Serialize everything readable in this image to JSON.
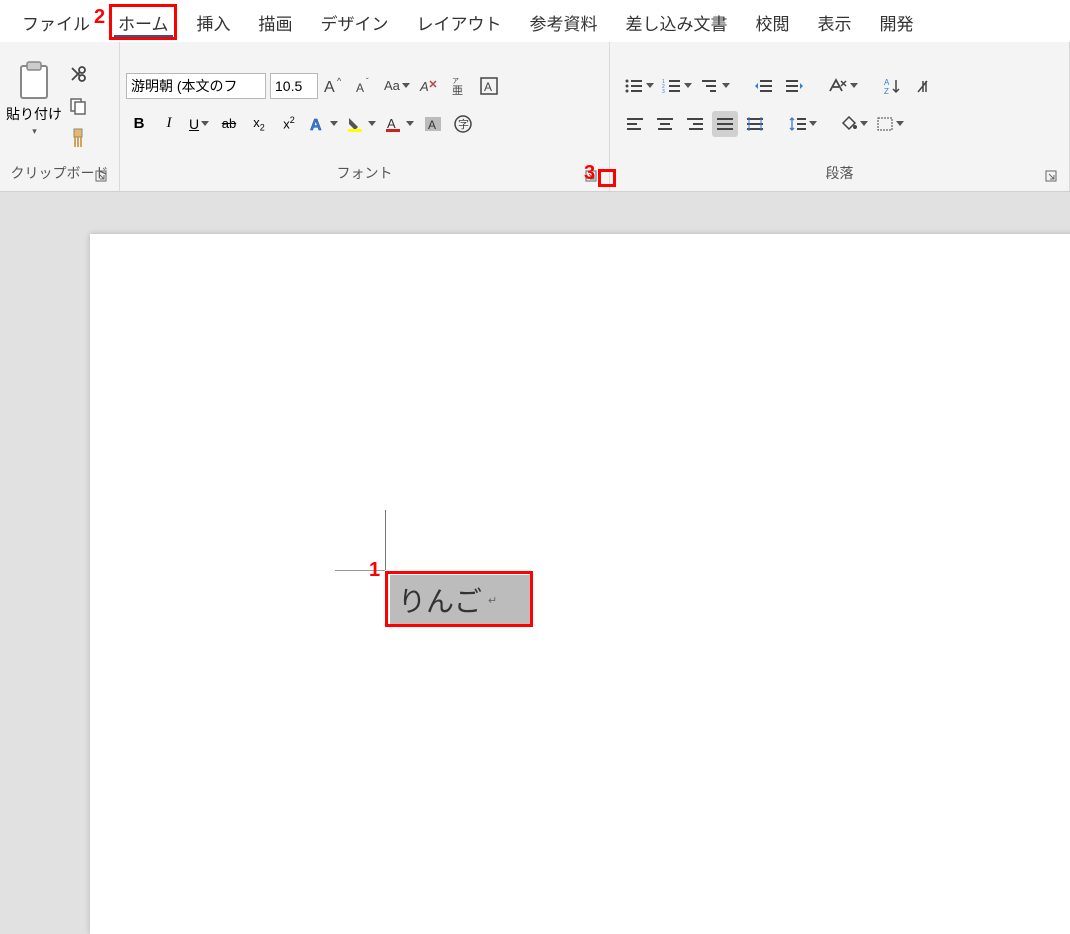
{
  "tabs": {
    "file": "ファイル",
    "home": "ホーム",
    "insert": "挿入",
    "draw": "描画",
    "design": "デザイン",
    "layout": "レイアウト",
    "references": "参考資料",
    "mailings": "差し込み文書",
    "review": "校閲",
    "view": "表示",
    "developer": "開発"
  },
  "clipboard": {
    "paste": "貼り付け",
    "label": "クリップボード"
  },
  "font": {
    "name": "游明朝 (本文のフ",
    "size": "10.5",
    "label": "フォント"
  },
  "paragraph": {
    "label": "段落"
  },
  "annotations": {
    "a1": "1",
    "a2": "2",
    "a3": "3"
  },
  "doc": {
    "selected_text": "りんご"
  }
}
